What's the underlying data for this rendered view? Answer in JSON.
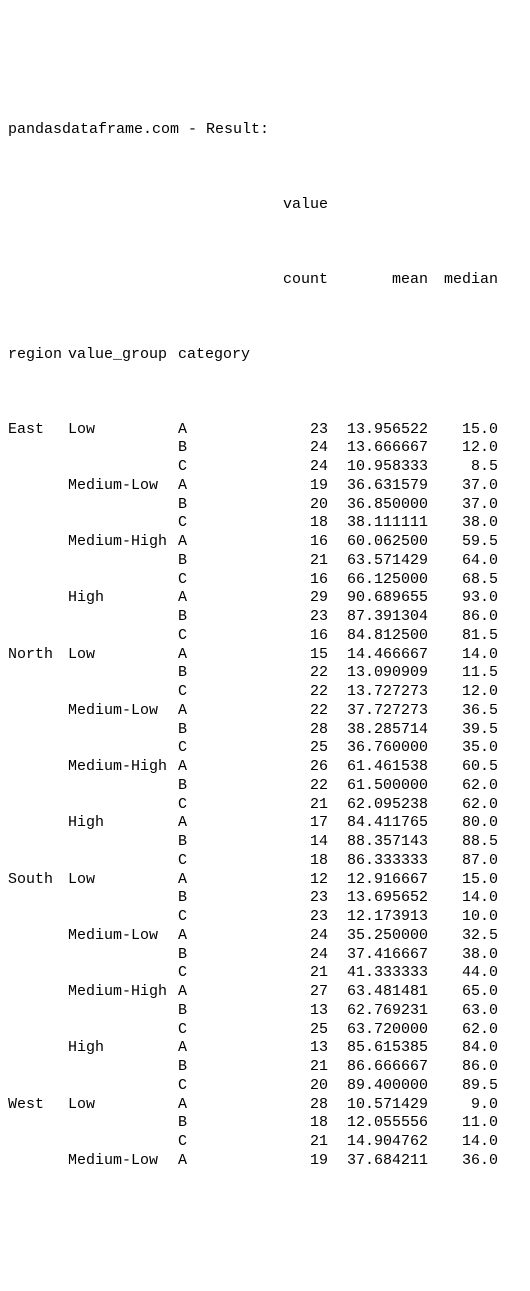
{
  "title": "pandasdataframe.com - Result:",
  "columns": {
    "top_value": "value",
    "count": "count",
    "mean": "mean",
    "median": "median"
  },
  "index_names": {
    "region": "region",
    "value_group": "value_group",
    "category": "category"
  },
  "rows": [
    {
      "region": "East",
      "value_group": "Low",
      "category": "A",
      "count": 23,
      "mean": "13.956522",
      "median": "15.0"
    },
    {
      "region": "",
      "value_group": "",
      "category": "B",
      "count": 24,
      "mean": "13.666667",
      "median": "12.0"
    },
    {
      "region": "",
      "value_group": "",
      "category": "C",
      "count": 24,
      "mean": "10.958333",
      "median": "8.5"
    },
    {
      "region": "",
      "value_group": "Medium-Low",
      "category": "A",
      "count": 19,
      "mean": "36.631579",
      "median": "37.0"
    },
    {
      "region": "",
      "value_group": "",
      "category": "B",
      "count": 20,
      "mean": "36.850000",
      "median": "37.0"
    },
    {
      "region": "",
      "value_group": "",
      "category": "C",
      "count": 18,
      "mean": "38.111111",
      "median": "38.0"
    },
    {
      "region": "",
      "value_group": "Medium-High",
      "category": "A",
      "count": 16,
      "mean": "60.062500",
      "median": "59.5"
    },
    {
      "region": "",
      "value_group": "",
      "category": "B",
      "count": 21,
      "mean": "63.571429",
      "median": "64.0"
    },
    {
      "region": "",
      "value_group": "",
      "category": "C",
      "count": 16,
      "mean": "66.125000",
      "median": "68.5"
    },
    {
      "region": "",
      "value_group": "High",
      "category": "A",
      "count": 29,
      "mean": "90.689655",
      "median": "93.0"
    },
    {
      "region": "",
      "value_group": "",
      "category": "B",
      "count": 23,
      "mean": "87.391304",
      "median": "86.0"
    },
    {
      "region": "",
      "value_group": "",
      "category": "C",
      "count": 16,
      "mean": "84.812500",
      "median": "81.5"
    },
    {
      "region": "North",
      "value_group": "Low",
      "category": "A",
      "count": 15,
      "mean": "14.466667",
      "median": "14.0"
    },
    {
      "region": "",
      "value_group": "",
      "category": "B",
      "count": 22,
      "mean": "13.090909",
      "median": "11.5"
    },
    {
      "region": "",
      "value_group": "",
      "category": "C",
      "count": 22,
      "mean": "13.727273",
      "median": "12.0"
    },
    {
      "region": "",
      "value_group": "Medium-Low",
      "category": "A",
      "count": 22,
      "mean": "37.727273",
      "median": "36.5"
    },
    {
      "region": "",
      "value_group": "",
      "category": "B",
      "count": 28,
      "mean": "38.285714",
      "median": "39.5"
    },
    {
      "region": "",
      "value_group": "",
      "category": "C",
      "count": 25,
      "mean": "36.760000",
      "median": "35.0"
    },
    {
      "region": "",
      "value_group": "Medium-High",
      "category": "A",
      "count": 26,
      "mean": "61.461538",
      "median": "60.5"
    },
    {
      "region": "",
      "value_group": "",
      "category": "B",
      "count": 22,
      "mean": "61.500000",
      "median": "62.0"
    },
    {
      "region": "",
      "value_group": "",
      "category": "C",
      "count": 21,
      "mean": "62.095238",
      "median": "62.0"
    },
    {
      "region": "",
      "value_group": "High",
      "category": "A",
      "count": 17,
      "mean": "84.411765",
      "median": "80.0"
    },
    {
      "region": "",
      "value_group": "",
      "category": "B",
      "count": 14,
      "mean": "88.357143",
      "median": "88.5"
    },
    {
      "region": "",
      "value_group": "",
      "category": "C",
      "count": 18,
      "mean": "86.333333",
      "median": "87.0"
    },
    {
      "region": "South",
      "value_group": "Low",
      "category": "A",
      "count": 12,
      "mean": "12.916667",
      "median": "15.0"
    },
    {
      "region": "",
      "value_group": "",
      "category": "B",
      "count": 23,
      "mean": "13.695652",
      "median": "14.0"
    },
    {
      "region": "",
      "value_group": "",
      "category": "C",
      "count": 23,
      "mean": "12.173913",
      "median": "10.0"
    },
    {
      "region": "",
      "value_group": "Medium-Low",
      "category": "A",
      "count": 24,
      "mean": "35.250000",
      "median": "32.5"
    },
    {
      "region": "",
      "value_group": "",
      "category": "B",
      "count": 24,
      "mean": "37.416667",
      "median": "38.0"
    },
    {
      "region": "",
      "value_group": "",
      "category": "C",
      "count": 21,
      "mean": "41.333333",
      "median": "44.0"
    },
    {
      "region": "",
      "value_group": "Medium-High",
      "category": "A",
      "count": 27,
      "mean": "63.481481",
      "median": "65.0"
    },
    {
      "region": "",
      "value_group": "",
      "category": "B",
      "count": 13,
      "mean": "62.769231",
      "median": "63.0"
    },
    {
      "region": "",
      "value_group": "",
      "category": "C",
      "count": 25,
      "mean": "63.720000",
      "median": "62.0"
    },
    {
      "region": "",
      "value_group": "High",
      "category": "A",
      "count": 13,
      "mean": "85.615385",
      "median": "84.0"
    },
    {
      "region": "",
      "value_group": "",
      "category": "B",
      "count": 21,
      "mean": "86.666667",
      "median": "86.0"
    },
    {
      "region": "",
      "value_group": "",
      "category": "C",
      "count": 20,
      "mean": "89.400000",
      "median": "89.5"
    },
    {
      "region": "West",
      "value_group": "Low",
      "category": "A",
      "count": 28,
      "mean": "10.571429",
      "median": "9.0"
    },
    {
      "region": "",
      "value_group": "",
      "category": "B",
      "count": 18,
      "mean": "12.055556",
      "median": "11.0"
    },
    {
      "region": "",
      "value_group": "",
      "category": "C",
      "count": 21,
      "mean": "14.904762",
      "median": "14.0"
    },
    {
      "region": "",
      "value_group": "Medium-Low",
      "category": "A",
      "count": 19,
      "mean": "37.684211",
      "median": "36.0"
    }
  ]
}
